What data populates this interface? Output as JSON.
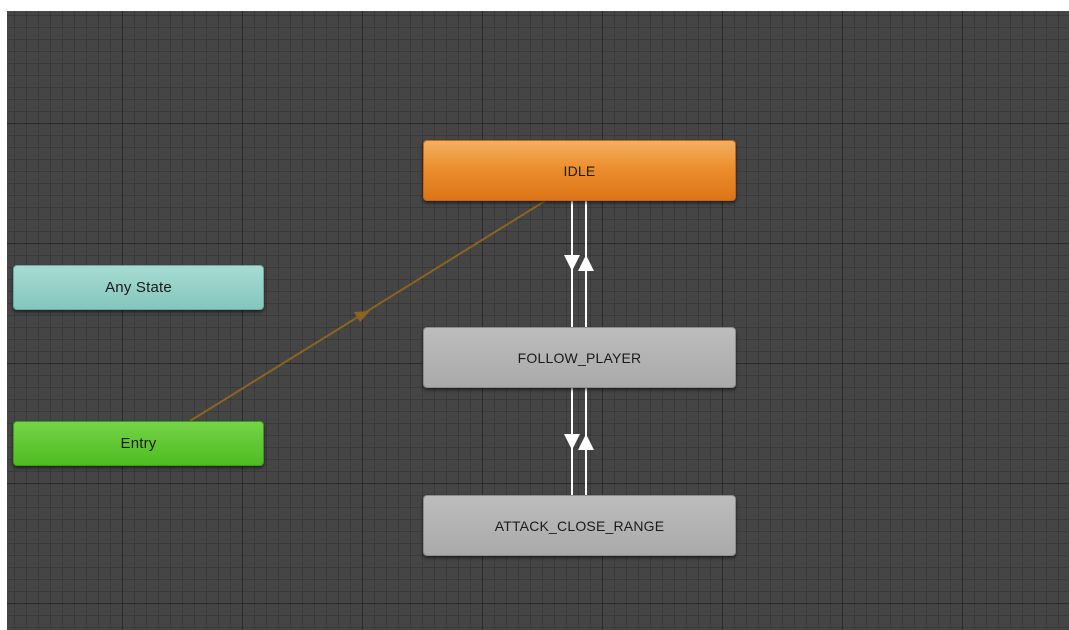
{
  "window": {
    "panel": "Animator state machine graph"
  },
  "states": {
    "idle": {
      "label": "IDLE",
      "kind": "default-state",
      "color": "#ec8f2e"
    },
    "any_state": {
      "label": "Any State",
      "kind": "any-state",
      "color": "#84c7bd"
    },
    "follow_player": {
      "label": "FOLLOW_PLAYER",
      "kind": "state",
      "color": "#a9a9a9"
    },
    "entry": {
      "label": "Entry",
      "kind": "entry",
      "color": "#4ebd22"
    },
    "attack_close_range": {
      "label": "ATTACK_CLOSE_RANGE",
      "kind": "state",
      "color": "#a9a9a9"
    }
  },
  "transitions": [
    {
      "from": "Entry",
      "to": "IDLE",
      "color": "#8a6420"
    },
    {
      "from": "IDLE",
      "to": "FOLLOW_PLAYER",
      "color": "#ffffff"
    },
    {
      "from": "FOLLOW_PLAYER",
      "to": "IDLE",
      "color": "#ffffff"
    },
    {
      "from": "FOLLOW_PLAYER",
      "to": "ATTACK_CLOSE_RANGE",
      "color": "#ffffff"
    },
    {
      "from": "ATTACK_CLOSE_RANGE",
      "to": "FOLLOW_PLAYER",
      "color": "#ffffff"
    }
  ]
}
